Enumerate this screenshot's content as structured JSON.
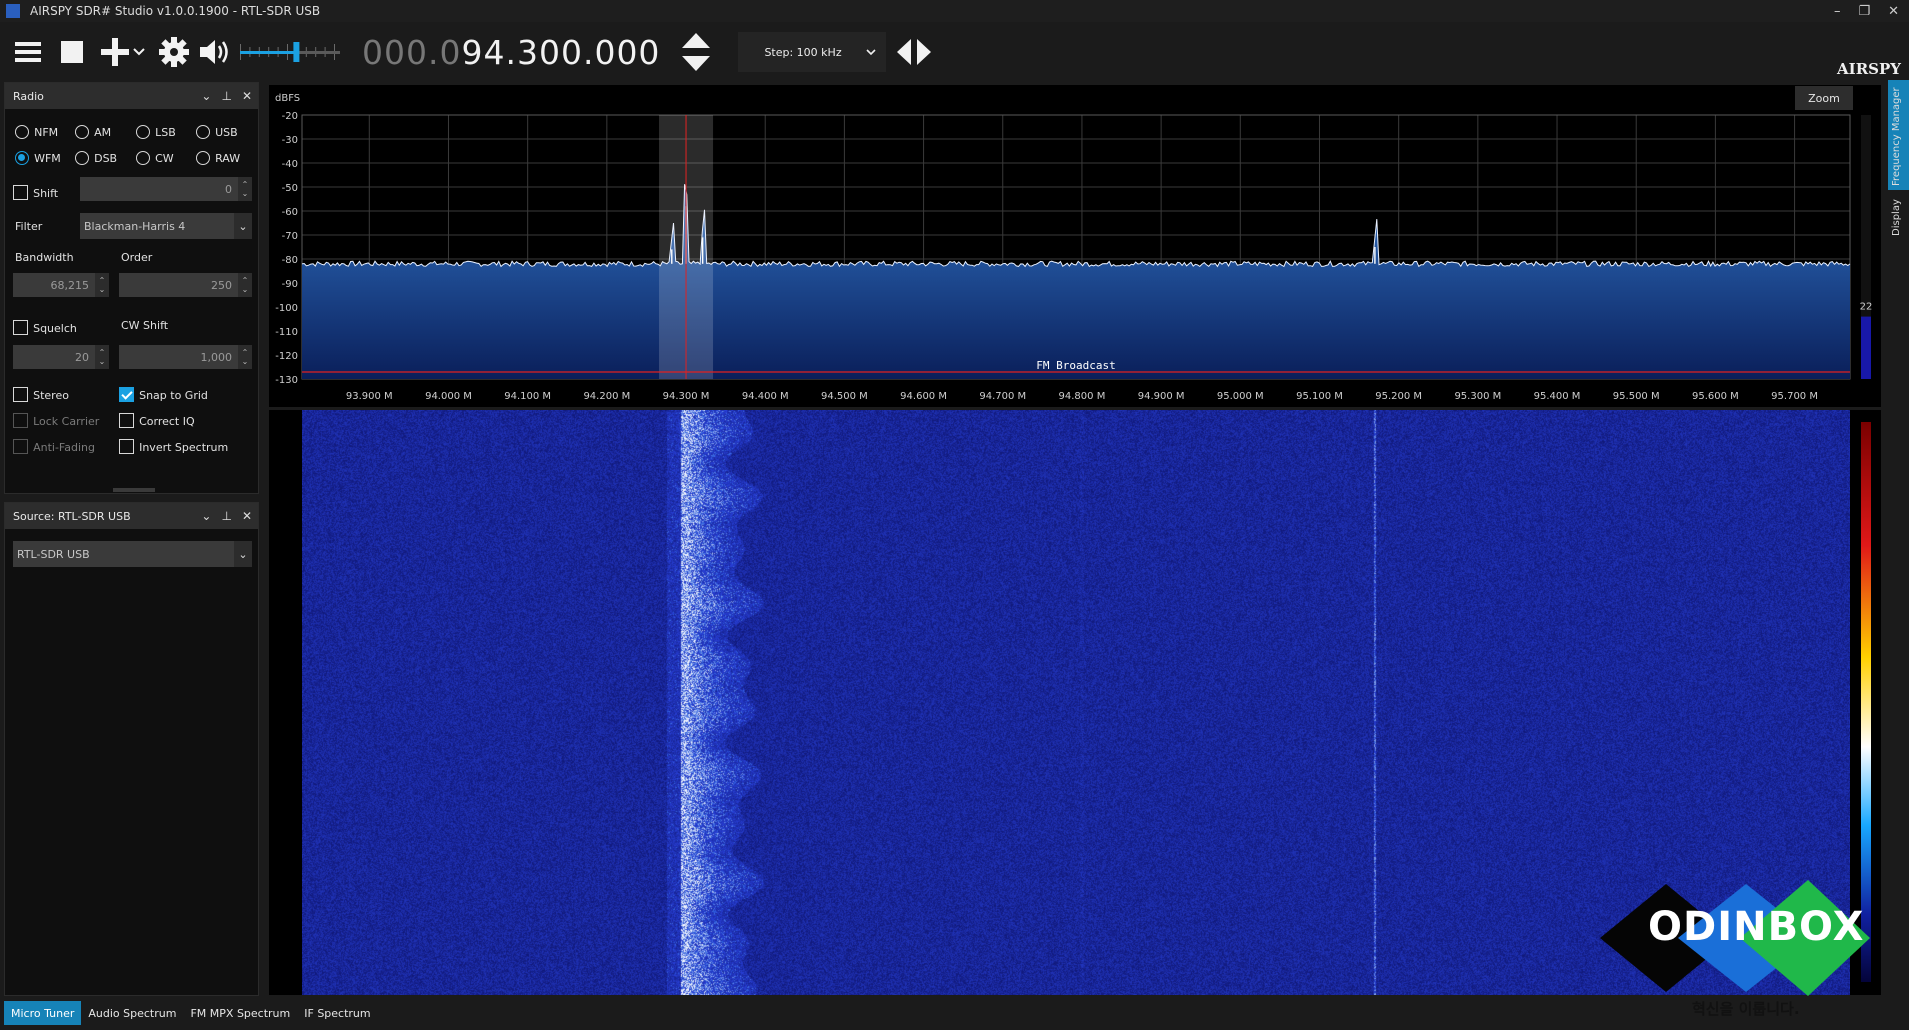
{
  "window": {
    "title": "AIRSPY SDR# Studio v1.0.0.1900 - RTL-SDR USB",
    "controls": {
      "minimize": "–",
      "restore": "❐",
      "close": "✕"
    }
  },
  "toolbar": {
    "frequency_dim": "000.0",
    "frequency_main": "94.300.000",
    "step_label": "Step: 100 kHz",
    "volume_level": 0.6,
    "brand": "AIRSPY"
  },
  "radio_panel": {
    "title": "Radio",
    "modes_row1": [
      "NFM",
      "AM",
      "LSB",
      "USB"
    ],
    "modes_row2": [
      "WFM",
      "DSB",
      "CW",
      "RAW"
    ],
    "selected_mode": "WFM",
    "shift_label": "Shift",
    "shift_value": "0",
    "filter_label": "Filter",
    "filter_value": "Blackman-Harris 4",
    "bandwidth_label": "Bandwidth",
    "bandwidth_value": "68,215",
    "order_label": "Order",
    "order_value": "250",
    "squelch_label": "Squelch",
    "squelch_value": "20",
    "cw_shift_label": "CW Shift",
    "cw_shift_value": "1,000",
    "stereo_label": "Stereo",
    "snap_label": "Snap to Grid",
    "lock_carrier_label": "Lock Carrier",
    "correct_iq_label": "Correct IQ",
    "anti_fading_label": "Anti-Fading",
    "invert_spectrum_label": "Invert Spectrum",
    "checked": {
      "shift": false,
      "squelch": false,
      "stereo": false,
      "snap_to_grid": true,
      "lock_carrier": false,
      "correct_iq": false,
      "anti_fading": false,
      "invert_spectrum": false
    }
  },
  "source_panel": {
    "title": "Source: RTL-SDR USB",
    "device_value": "RTL-SDR USB"
  },
  "spectrum": {
    "unit_label": "dBFS",
    "zoom_label": "Zoom",
    "band_label": "FM Broadcast",
    "side_value": "22",
    "db_ticks": [
      "-20",
      "-30",
      "-40",
      "-50",
      "-60",
      "-70",
      "-80",
      "-90",
      "-100",
      "-110",
      "-120",
      "-130"
    ],
    "freq_ticks": [
      "93.900 M",
      "94.000 M",
      "94.100 M",
      "94.200 M",
      "94.300 M",
      "94.400 M",
      "94.500 M",
      "94.600 M",
      "94.700 M",
      "94.800 M",
      "94.900 M",
      "95.000 M",
      "95.100 M",
      "95.200 M",
      "95.300 M",
      "95.400 M",
      "95.500 M",
      "95.600 M",
      "95.700 M"
    ],
    "tuned_mhz": 94.3,
    "filter_bandwidth_khz": 68.215,
    "noise_floor_dbfs": -82,
    "peaks": [
      {
        "mhz": 94.282,
        "dbfs": -76
      },
      {
        "mhz": 94.3,
        "dbfs": -58
      },
      {
        "mhz": 94.321,
        "dbfs": -71
      },
      {
        "mhz": 95.17,
        "dbfs": -75
      }
    ]
  },
  "right_tabs": {
    "frequency_manager": "Frequency Manager",
    "display": "Display"
  },
  "bottom_tabs": [
    "Micro Tuner",
    "Audio Spectrum",
    "FM MPX Spectrum",
    "IF Spectrum"
  ],
  "watermark": {
    "text": "ODINBOX",
    "subtext": "혁신을 이룹니다."
  }
}
